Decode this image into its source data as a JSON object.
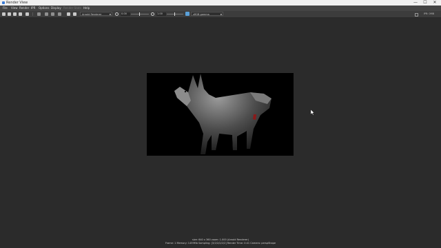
{
  "window": {
    "title": "Render View",
    "controls": {
      "minimize": "—",
      "maximize": "☐",
      "close": "✕"
    }
  },
  "menu": {
    "items": [
      "File",
      "View",
      "Render",
      "IPR",
      "Options",
      "Display",
      "Render Stats",
      "Help"
    ],
    "disabled_item": "Render Stats"
  },
  "toolbar": {
    "renderer": "Arnold Renderer",
    "exposure": "0.00",
    "gamma": "1.00",
    "color_space": "sRGB gamma",
    "ipr_label": "IPR: 0MB"
  },
  "status": {
    "line1": "size: 640 x 360 zoom: 1.000    (Arnold Renderer)",
    "line2": "Frame: 1    Memory: 1459Mb    Sampling: [3/2/2/2/2/2]    Render Time: 0:41    Camera: perspShape"
  },
  "icons": [
    "render-icon",
    "render-region-icon",
    "snapshot-icon",
    "ipr-icon",
    "keep-image-icon",
    "remove-image-icon",
    "one-to-one-icon",
    "color-channel-icon",
    "exposure-reset-icon",
    "gamma-reset-icon",
    "cursor-arrow-icon"
  ],
  "colors": {
    "background": "#2b2b2b",
    "render_frame": "#000000",
    "accent": "#5aa0d8"
  }
}
